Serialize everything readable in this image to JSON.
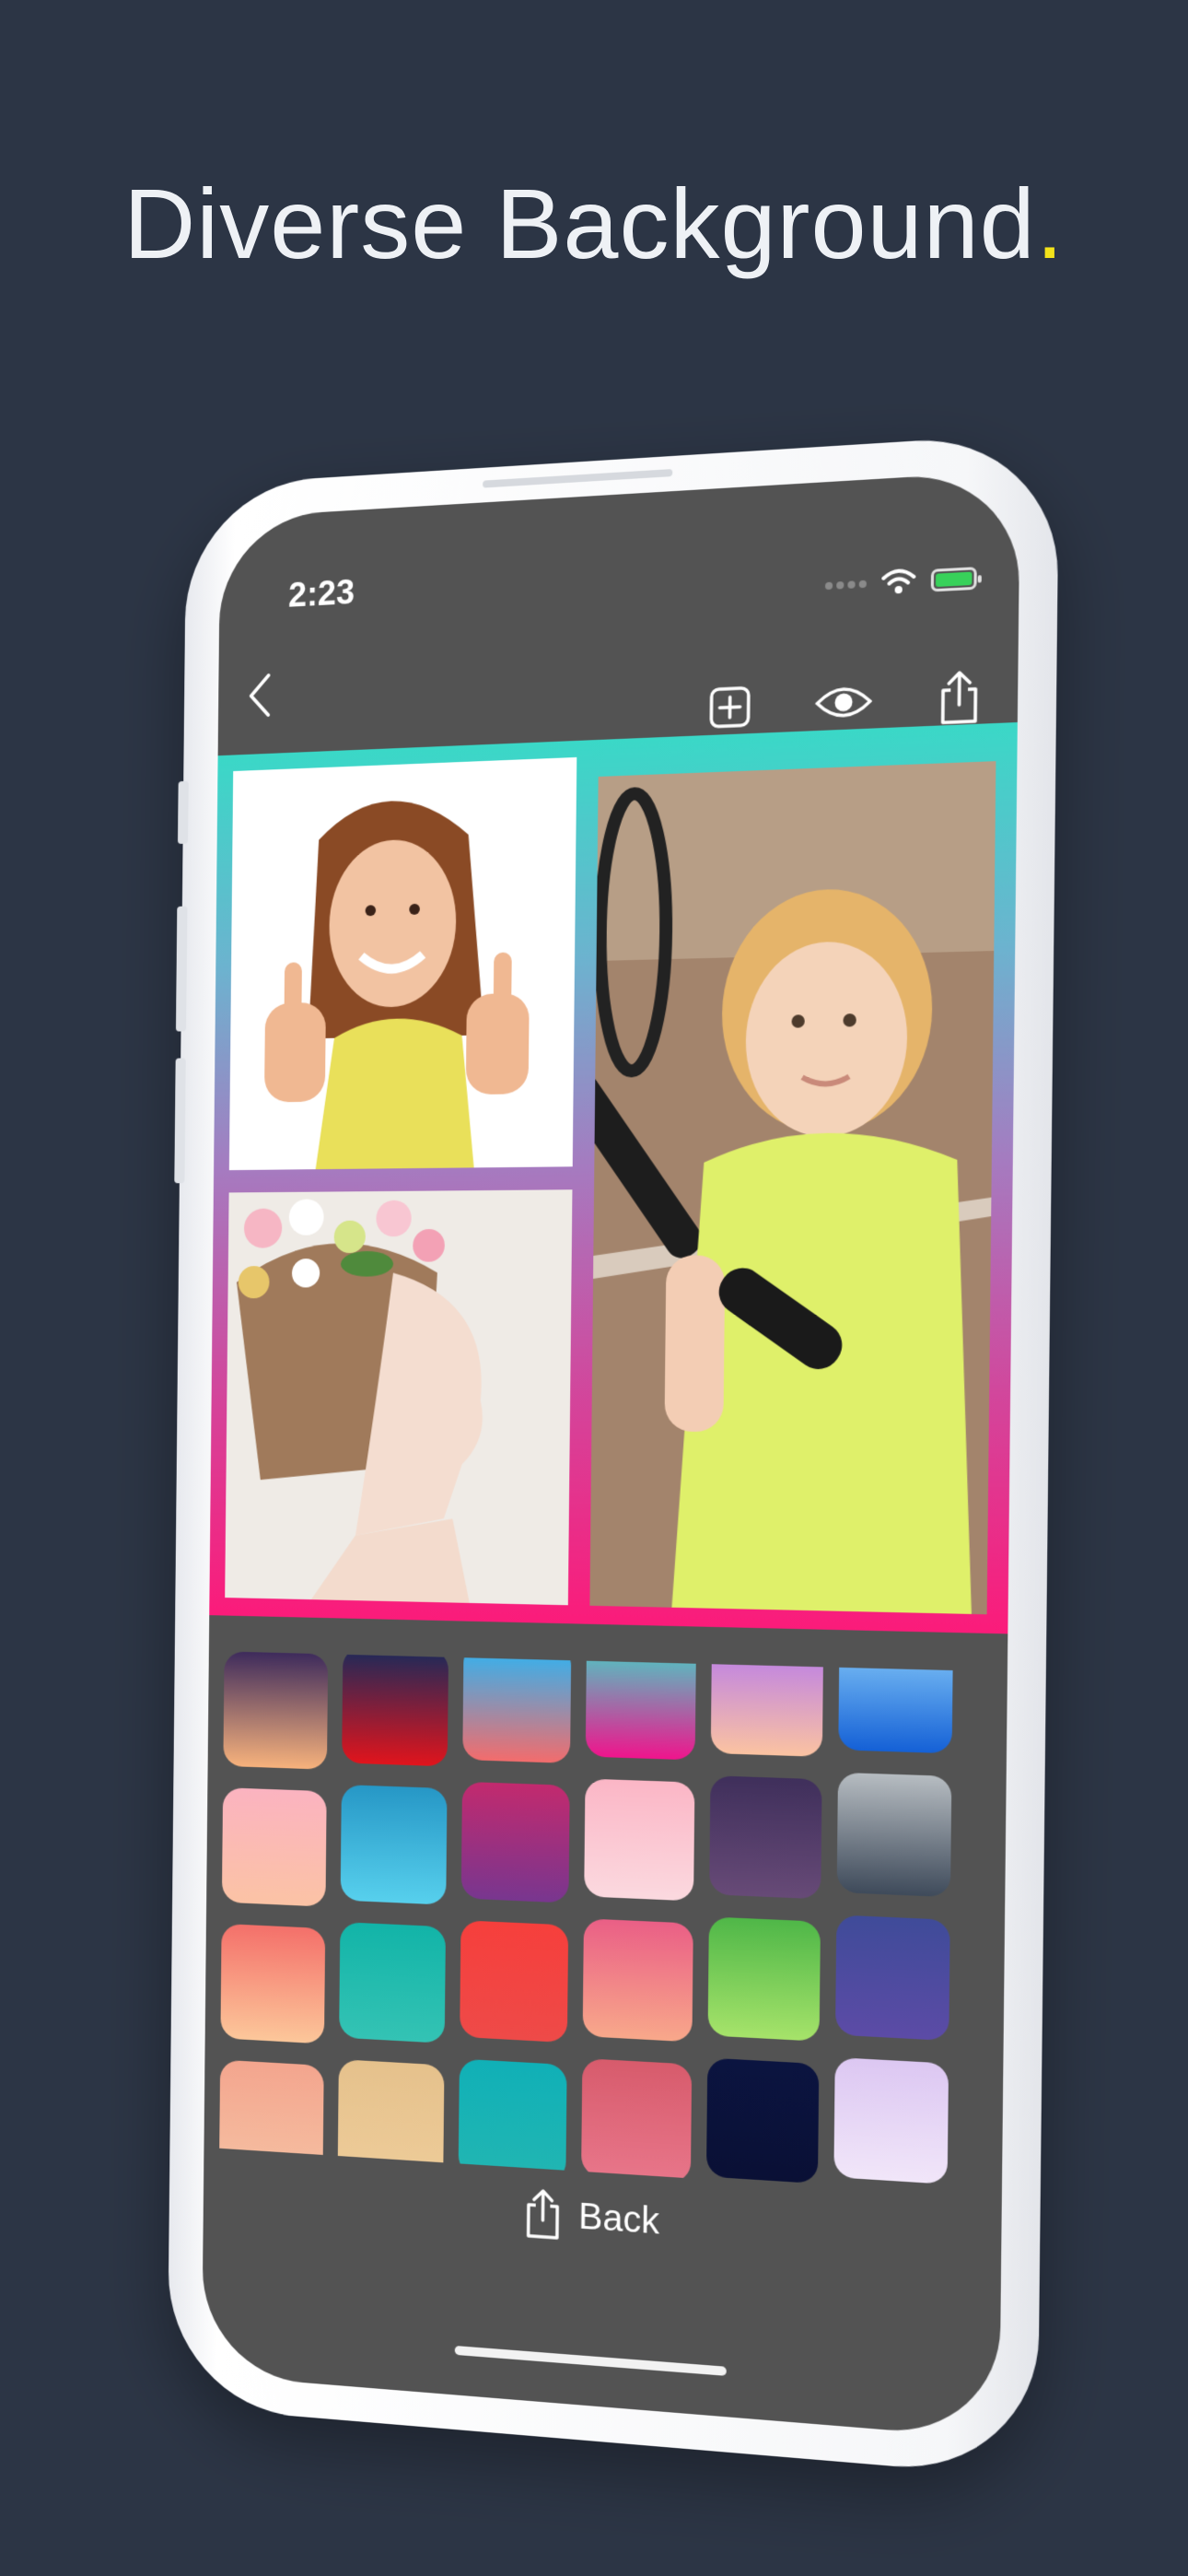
{
  "headline": {
    "text": "Diverse Background",
    "dot": "."
  },
  "status_bar": {
    "time": "2:23"
  },
  "toolbar": {
    "icons": [
      "back-chevron-icon",
      "add-square-icon",
      "eye-icon",
      "share-icon"
    ]
  },
  "collage": {
    "border_gradient": [
      "#3ad8c7",
      "#a57bc0",
      "#fb1b7a"
    ],
    "photos": [
      {
        "name": "photo-girl-thumbs-up"
      },
      {
        "name": "photo-woman-flower-crown"
      },
      {
        "name": "photo-girl-tennis-racket"
      }
    ]
  },
  "swatches": [
    [
      "#3e2b5c",
      "#f7b27c"
    ],
    [
      "#1b2a5a",
      "#e1141c"
    ],
    [
      "#29b6f6",
      "#f36c6c"
    ],
    [
      "#3fd8c9",
      "#f0148c"
    ],
    [
      "#b376f0",
      "#fbc3a1"
    ],
    [
      "#8ed1fb",
      "#1460d6"
    ],
    [
      "#fbb3c0",
      "#fbc3a5"
    ],
    [
      "#2697c6",
      "#57d0ed"
    ],
    [
      "#c22a6e",
      "#78368f"
    ],
    [
      "#fbb6c6",
      "#fbd9df"
    ],
    [
      "#3f2f5b",
      "#674a77"
    ],
    [
      "#b6bcc1",
      "#3e4a5a"
    ],
    [
      "#f4706a",
      "#fcc79a"
    ],
    [
      "#12b4a8",
      "#34c3b4"
    ],
    [
      "#f63f3c",
      "#ee4a48"
    ],
    [
      "#ea5f86",
      "#f8a88a"
    ],
    [
      "#4fb748",
      "#a6e36a"
    ],
    [
      "#3f4b99",
      "#5c4ba6"
    ],
    [
      "#f3a58e",
      "#f6c0a2"
    ],
    [
      "#e5c18c",
      "#eecc99"
    ],
    [
      "#10b0b7",
      "#22b6b2"
    ],
    [
      "#d75b6c",
      "#e8768a"
    ],
    [
      "#0b1440",
      "#0a1035"
    ],
    [
      "#dcc7f2",
      "#f1e6f9"
    ]
  ],
  "bottom_bar": {
    "back_label": "Back"
  }
}
